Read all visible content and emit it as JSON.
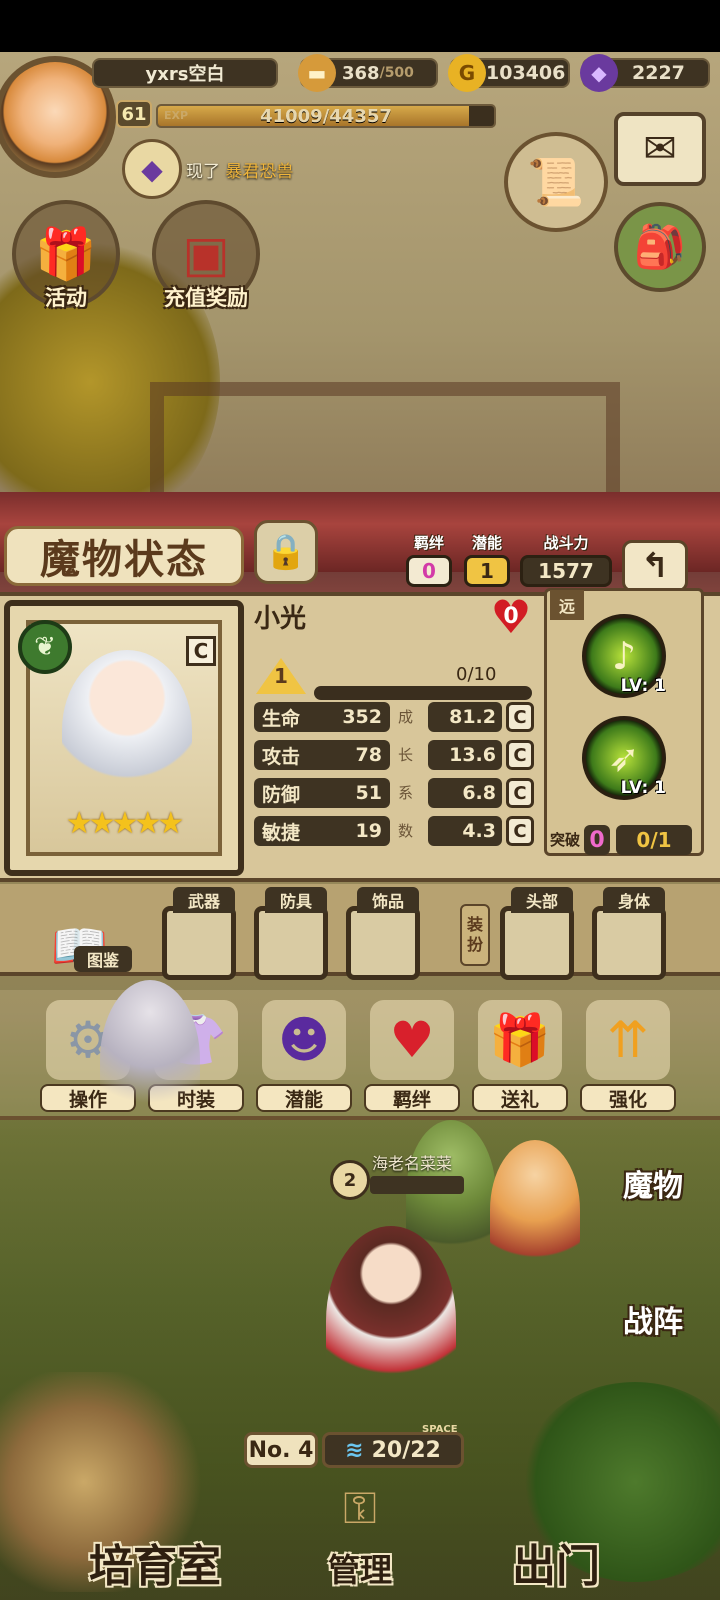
{
  "player": {
    "name": "yxrs空白",
    "level": "61",
    "exp_tag": "EXP",
    "exp_text": "41009/44357",
    "exp_fraction": 0.9245
  },
  "resources": {
    "bread": "368",
    "bread_max": "/500",
    "gold": "103406",
    "gems": "2227"
  },
  "notice": {
    "text": "现了",
    "highlight": "暴君恐兽"
  },
  "menu": {
    "activity": "活动",
    "recharge": "充值奖励"
  },
  "monster": {
    "title": "魔物状态",
    "bond_label": "羁绊",
    "bond_value": "0",
    "potential_label": "潜能",
    "potential_value": "1",
    "power_label": "战斗力",
    "power_value": "1577",
    "name": "小光",
    "heart_value": "0",
    "rank": "C",
    "star_level": "1",
    "progress": "0/10",
    "stars": "★★★★★",
    "stats": [
      {
        "label": "生命",
        "value": "352",
        "growth_char": "成",
        "growth": "81.2",
        "grade": "C"
      },
      {
        "label": "攻击",
        "value": "78",
        "growth_char": "长",
        "growth": "13.6",
        "grade": "C"
      },
      {
        "label": "防御",
        "value": "51",
        "growth_char": "系",
        "growth": "6.8",
        "grade": "C"
      },
      {
        "label": "敏捷",
        "value": "19",
        "growth_char": "数",
        "growth": "4.3",
        "grade": "C"
      }
    ],
    "range_label": "远",
    "skills": [
      {
        "level": "LV: 1",
        "icon": "harp-skill-icon"
      },
      {
        "level": "LV: 1",
        "icon": "arrow-skill-icon"
      }
    ],
    "breakthrough_label": "突破",
    "breakthrough_value": "0",
    "breakthrough_progress": "0/1"
  },
  "equipment": {
    "book_label": "图鉴",
    "slots_left": [
      "武器",
      "防具",
      "饰品"
    ],
    "equip_tag": "装扮",
    "slots_right": [
      "头部",
      "身体"
    ]
  },
  "actions": [
    {
      "label": "操作",
      "icon": "gear-icon"
    },
    {
      "label": "时装",
      "icon": "outfit-icon"
    },
    {
      "label": "潜能",
      "icon": "shadow-icon"
    },
    {
      "label": "羁绊",
      "icon": "heart-icon"
    },
    {
      "label": "送礼",
      "icon": "gift-icon"
    },
    {
      "label": "强化",
      "icon": "upgrade-icon"
    }
  ],
  "npc": {
    "name": "海老名菜菜",
    "level": "2",
    "level_tag": "LEVEL",
    "exp_tag": "EXP"
  },
  "side": {
    "monster": "魔物",
    "battle": "战阵"
  },
  "capacity": {
    "number": "No. 4",
    "space_tag": "SPACE",
    "space": "20/22"
  },
  "nav": {
    "nursery": "培育室",
    "manage": "管理",
    "exit": "出门"
  }
}
